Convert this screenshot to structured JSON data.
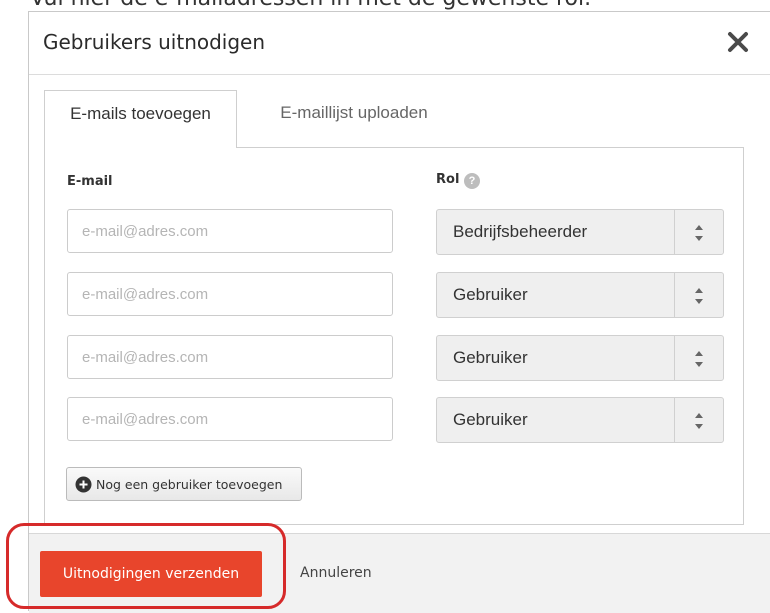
{
  "caption": "Vul hier de e-mailadressen in met de gewenste rol.",
  "dialog": {
    "title": "Gebruikers uitnodigen",
    "close_icon": "close-icon"
  },
  "tabs": [
    {
      "label": "E-mails toevoegen",
      "active": true
    },
    {
      "label": "E-maillijst uploaden",
      "active": false
    }
  ],
  "form": {
    "email_label": "E-mail",
    "role_label": "Rol",
    "role_help_icon": "question-icon",
    "rows": [
      {
        "email_placeholder": "e-mail@adres.com",
        "email_value": "",
        "role": "Bedrijfsbeheerder"
      },
      {
        "email_placeholder": "e-mail@adres.com",
        "email_value": "",
        "role": "Gebruiker"
      },
      {
        "email_placeholder": "e-mail@adres.com",
        "email_value": "",
        "role": "Gebruiker"
      },
      {
        "email_placeholder": "e-mail@adres.com",
        "email_value": "",
        "role": "Gebruiker"
      }
    ],
    "add_user_label": "Nog een gebruiker toevoegen",
    "add_user_icon": "plus-circle-icon"
  },
  "footer": {
    "send_label": "Uitnodigingen verzenden",
    "cancel_label": "Annuleren"
  },
  "colors": {
    "primary_button": "#e8452c",
    "highlight_ring": "#d62a2a",
    "select_background": "#efefef"
  }
}
